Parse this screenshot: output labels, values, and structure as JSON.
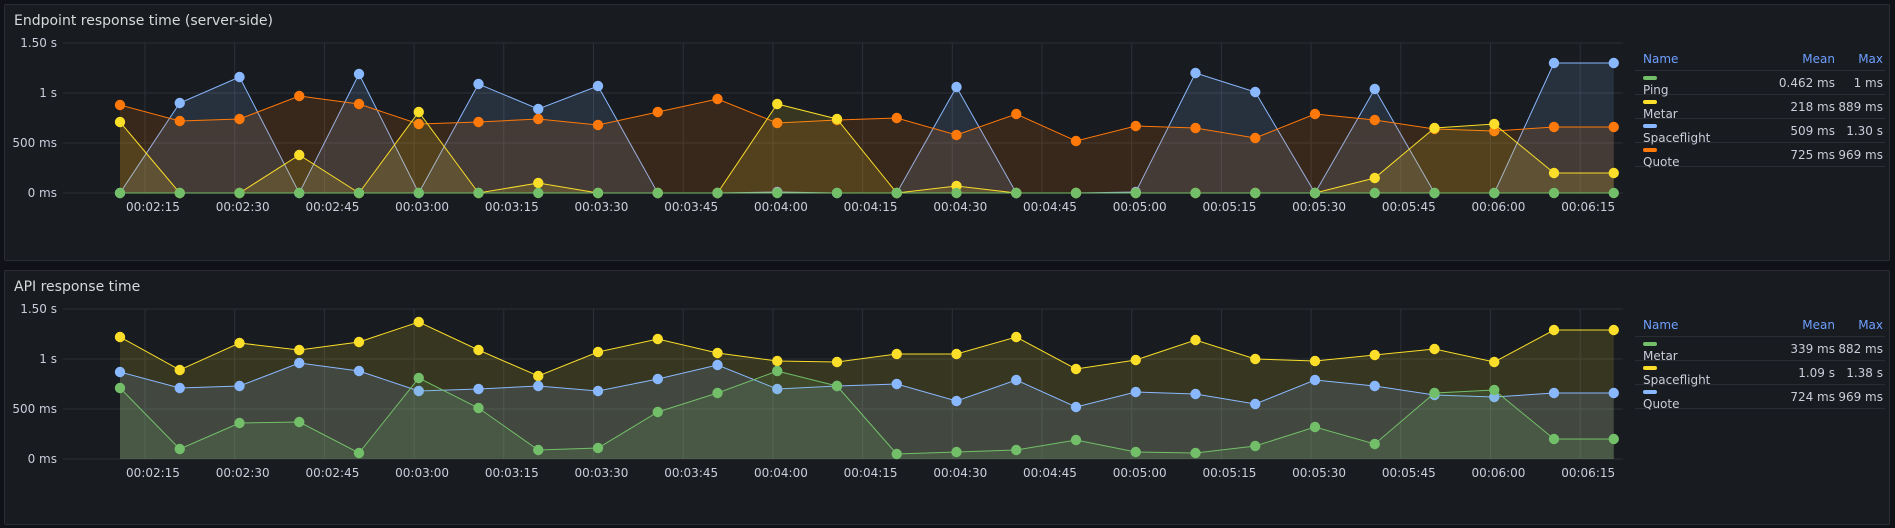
{
  "panels": [
    {
      "title": "Endpoint response time (server-side)",
      "legend": {
        "headers": {
          "name": "Name",
          "mean": "Mean",
          "max": "Max"
        },
        "rows": [
          {
            "name": "Ping",
            "mean": "0.462 ms",
            "max": "1 ms",
            "color": "#73bf69"
          },
          {
            "name": "Metar",
            "mean": "218 ms",
            "max": "889 ms",
            "color": "#fade2a"
          },
          {
            "name": "Spaceflight",
            "mean": "509 ms",
            "max": "1.30 s",
            "color": "#8ab8ff"
          },
          {
            "name": "Quote",
            "mean": "725 ms",
            "max": "969 ms",
            "color": "#ff780a"
          }
        ]
      }
    },
    {
      "title": "API response time",
      "legend": {
        "headers": {
          "name": "Name",
          "mean": "Mean",
          "max": "Max"
        },
        "rows": [
          {
            "name": "Metar",
            "mean": "339 ms",
            "max": "882 ms",
            "color": "#73bf69"
          },
          {
            "name": "Spaceflight",
            "mean": "1.09 s",
            "max": "1.38 s",
            "color": "#fade2a"
          },
          {
            "name": "Quote",
            "mean": "724 ms",
            "max": "969 ms",
            "color": "#8ab8ff"
          }
        ]
      }
    }
  ],
  "chart_data": [
    {
      "type": "line",
      "title": "Endpoint response time (server-side)",
      "x": [
        "00:02:05",
        "00:02:15",
        "00:02:25",
        "00:02:35",
        "00:02:45",
        "00:02:55",
        "00:03:05",
        "00:03:15",
        "00:03:25",
        "00:03:35",
        "00:03:45",
        "00:03:55",
        "00:04:05",
        "00:04:15",
        "00:04:25",
        "00:04:35",
        "00:04:45",
        "00:04:55",
        "00:05:05",
        "00:05:15",
        "00:05:25",
        "00:05:35",
        "00:05:45",
        "00:05:55",
        "00:06:05",
        "00:06:15",
        "00:06:25"
      ],
      "xticks": [
        "00:02:15",
        "00:02:30",
        "00:02:45",
        "00:03:00",
        "00:03:15",
        "00:03:30",
        "00:03:45",
        "00:04:00",
        "00:04:15",
        "00:04:30",
        "00:04:45",
        "00:05:00",
        "00:05:15",
        "00:05:30",
        "00:05:45",
        "00:06:00",
        "00:06:15"
      ],
      "yticks": [
        "0 ms",
        "500 ms",
        "1 s",
        "1.50 s"
      ],
      "ylim": [
        0,
        1.5
      ],
      "yunit": "s",
      "grid": true,
      "legend_position": "right",
      "series": [
        {
          "name": "Spaceflight",
          "color": "#8ab8ff",
          "values": [
            0,
            0.9,
            1.16,
            0,
            1.19,
            0,
            1.09,
            0.84,
            1.07,
            0,
            0,
            0.01,
            0,
            0,
            1.06,
            0,
            0,
            0.01,
            1.2,
            1.01,
            0,
            1.04,
            0,
            0,
            1.3,
            1.3
          ]
        },
        {
          "name": "Quote",
          "color": "#ff780a",
          "values": [
            0.88,
            0.72,
            0.74,
            0.97,
            0.89,
            0.69,
            0.71,
            0.74,
            0.68,
            0.81,
            0.94,
            0.7,
            0.73,
            0.75,
            0.58,
            0.79,
            0.52,
            0.67,
            0.65,
            0.55,
            0.79,
            0.73,
            0.64,
            0.62,
            0.66,
            0.66
          ]
        },
        {
          "name": "Metar",
          "color": "#fade2a",
          "values": [
            0.71,
            0,
            0,
            0.38,
            0,
            0.81,
            0,
            0.1,
            0,
            0,
            0,
            0.89,
            0.74,
            0,
            0.07,
            0,
            0,
            0,
            0,
            0,
            0,
            0.15,
            0.65,
            0.69,
            0.2,
            0.2
          ]
        },
        {
          "name": "Ping",
          "color": "#73bf69",
          "values": [
            0,
            0,
            0,
            0,
            0,
            0,
            0,
            0,
            0,
            0,
            0,
            0,
            0,
            0,
            0,
            0,
            0,
            0,
            0,
            0,
            0,
            0,
            0,
            0,
            0,
            0
          ]
        }
      ]
    },
    {
      "type": "line",
      "title": "API response time",
      "x": [
        "00:02:05",
        "00:02:15",
        "00:02:25",
        "00:02:35",
        "00:02:45",
        "00:02:55",
        "00:03:05",
        "00:03:15",
        "00:03:25",
        "00:03:35",
        "00:03:45",
        "00:03:55",
        "00:04:05",
        "00:04:15",
        "00:04:25",
        "00:04:35",
        "00:04:45",
        "00:04:55",
        "00:05:05",
        "00:05:15",
        "00:05:25",
        "00:05:35",
        "00:05:45",
        "00:05:55",
        "00:06:05",
        "00:06:15",
        "00:06:25"
      ],
      "xticks": [
        "00:02:15",
        "00:02:30",
        "00:02:45",
        "00:03:00",
        "00:03:15",
        "00:03:30",
        "00:03:45",
        "00:04:00",
        "00:04:15",
        "00:04:30",
        "00:04:45",
        "00:05:00",
        "00:05:15",
        "00:05:30",
        "00:05:45",
        "00:06:00",
        "00:06:15"
      ],
      "yticks": [
        "0 ms",
        "500 ms",
        "1 s",
        "1.50 s"
      ],
      "ylim": [
        0,
        1.5
      ],
      "yunit": "s",
      "grid": true,
      "legend_position": "right",
      "series": [
        {
          "name": "Spaceflight",
          "color": "#fade2a",
          "values": [
            1.22,
            0.89,
            1.16,
            1.09,
            1.17,
            1.37,
            1.09,
            0.83,
            1.07,
            1.2,
            1.06,
            0.98,
            0.97,
            1.05,
            1.05,
            1.22,
            0.9,
            0.99,
            1.19,
            1.0,
            0.98,
            1.04,
            1.1,
            0.97,
            1.29,
            1.29
          ]
        },
        {
          "name": "Quote",
          "color": "#8ab8ff",
          "values": [
            0.87,
            0.71,
            0.73,
            0.96,
            0.88,
            0.68,
            0.7,
            0.73,
            0.68,
            0.8,
            0.94,
            0.7,
            0.73,
            0.75,
            0.58,
            0.79,
            0.52,
            0.67,
            0.65,
            0.55,
            0.79,
            0.73,
            0.64,
            0.62,
            0.66,
            0.66
          ]
        },
        {
          "name": "Metar",
          "color": "#73bf69",
          "values": [
            0.71,
            0.1,
            0.36,
            0.37,
            0.06,
            0.81,
            0.51,
            0.09,
            0.11,
            0.47,
            0.66,
            0.88,
            0.73,
            0.05,
            0.07,
            0.09,
            0.19,
            0.07,
            0.06,
            0.13,
            0.32,
            0.15,
            0.66,
            0.69,
            0.2,
            0.2
          ]
        }
      ]
    }
  ]
}
